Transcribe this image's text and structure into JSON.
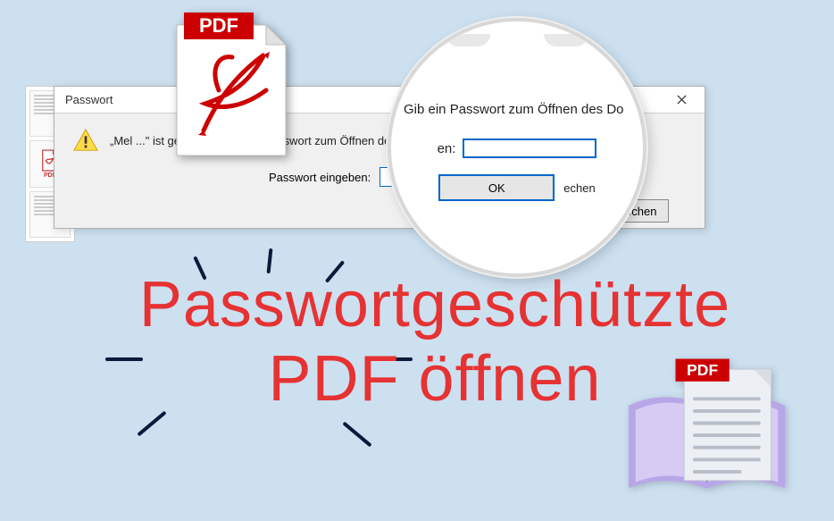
{
  "dialog": {
    "title": "Passwort",
    "message": "„Mel                          ...\" ist geschützt. Gib ein Passwort zum Öffnen des Dokuments ein.",
    "password_label": "Passwort eingeben:",
    "ok_label": "OK",
    "cancel_label": "Abbrechen",
    "password_value": ""
  },
  "magnifier": {
    "prompt": "Gib ein Passwort zum Öffnen des Do",
    "label_suffix": "en:",
    "ok_label": "OK",
    "cancel_fragment": "echen"
  },
  "pdf_icon": {
    "badge_text": "PDF"
  },
  "book_icon": {
    "badge_text": "PDF"
  },
  "headline": {
    "line1": "Passwortgeschützte",
    "line2": "PDF öffnen"
  },
  "thumbs": {
    "pdf_mini_label": "PDF"
  }
}
